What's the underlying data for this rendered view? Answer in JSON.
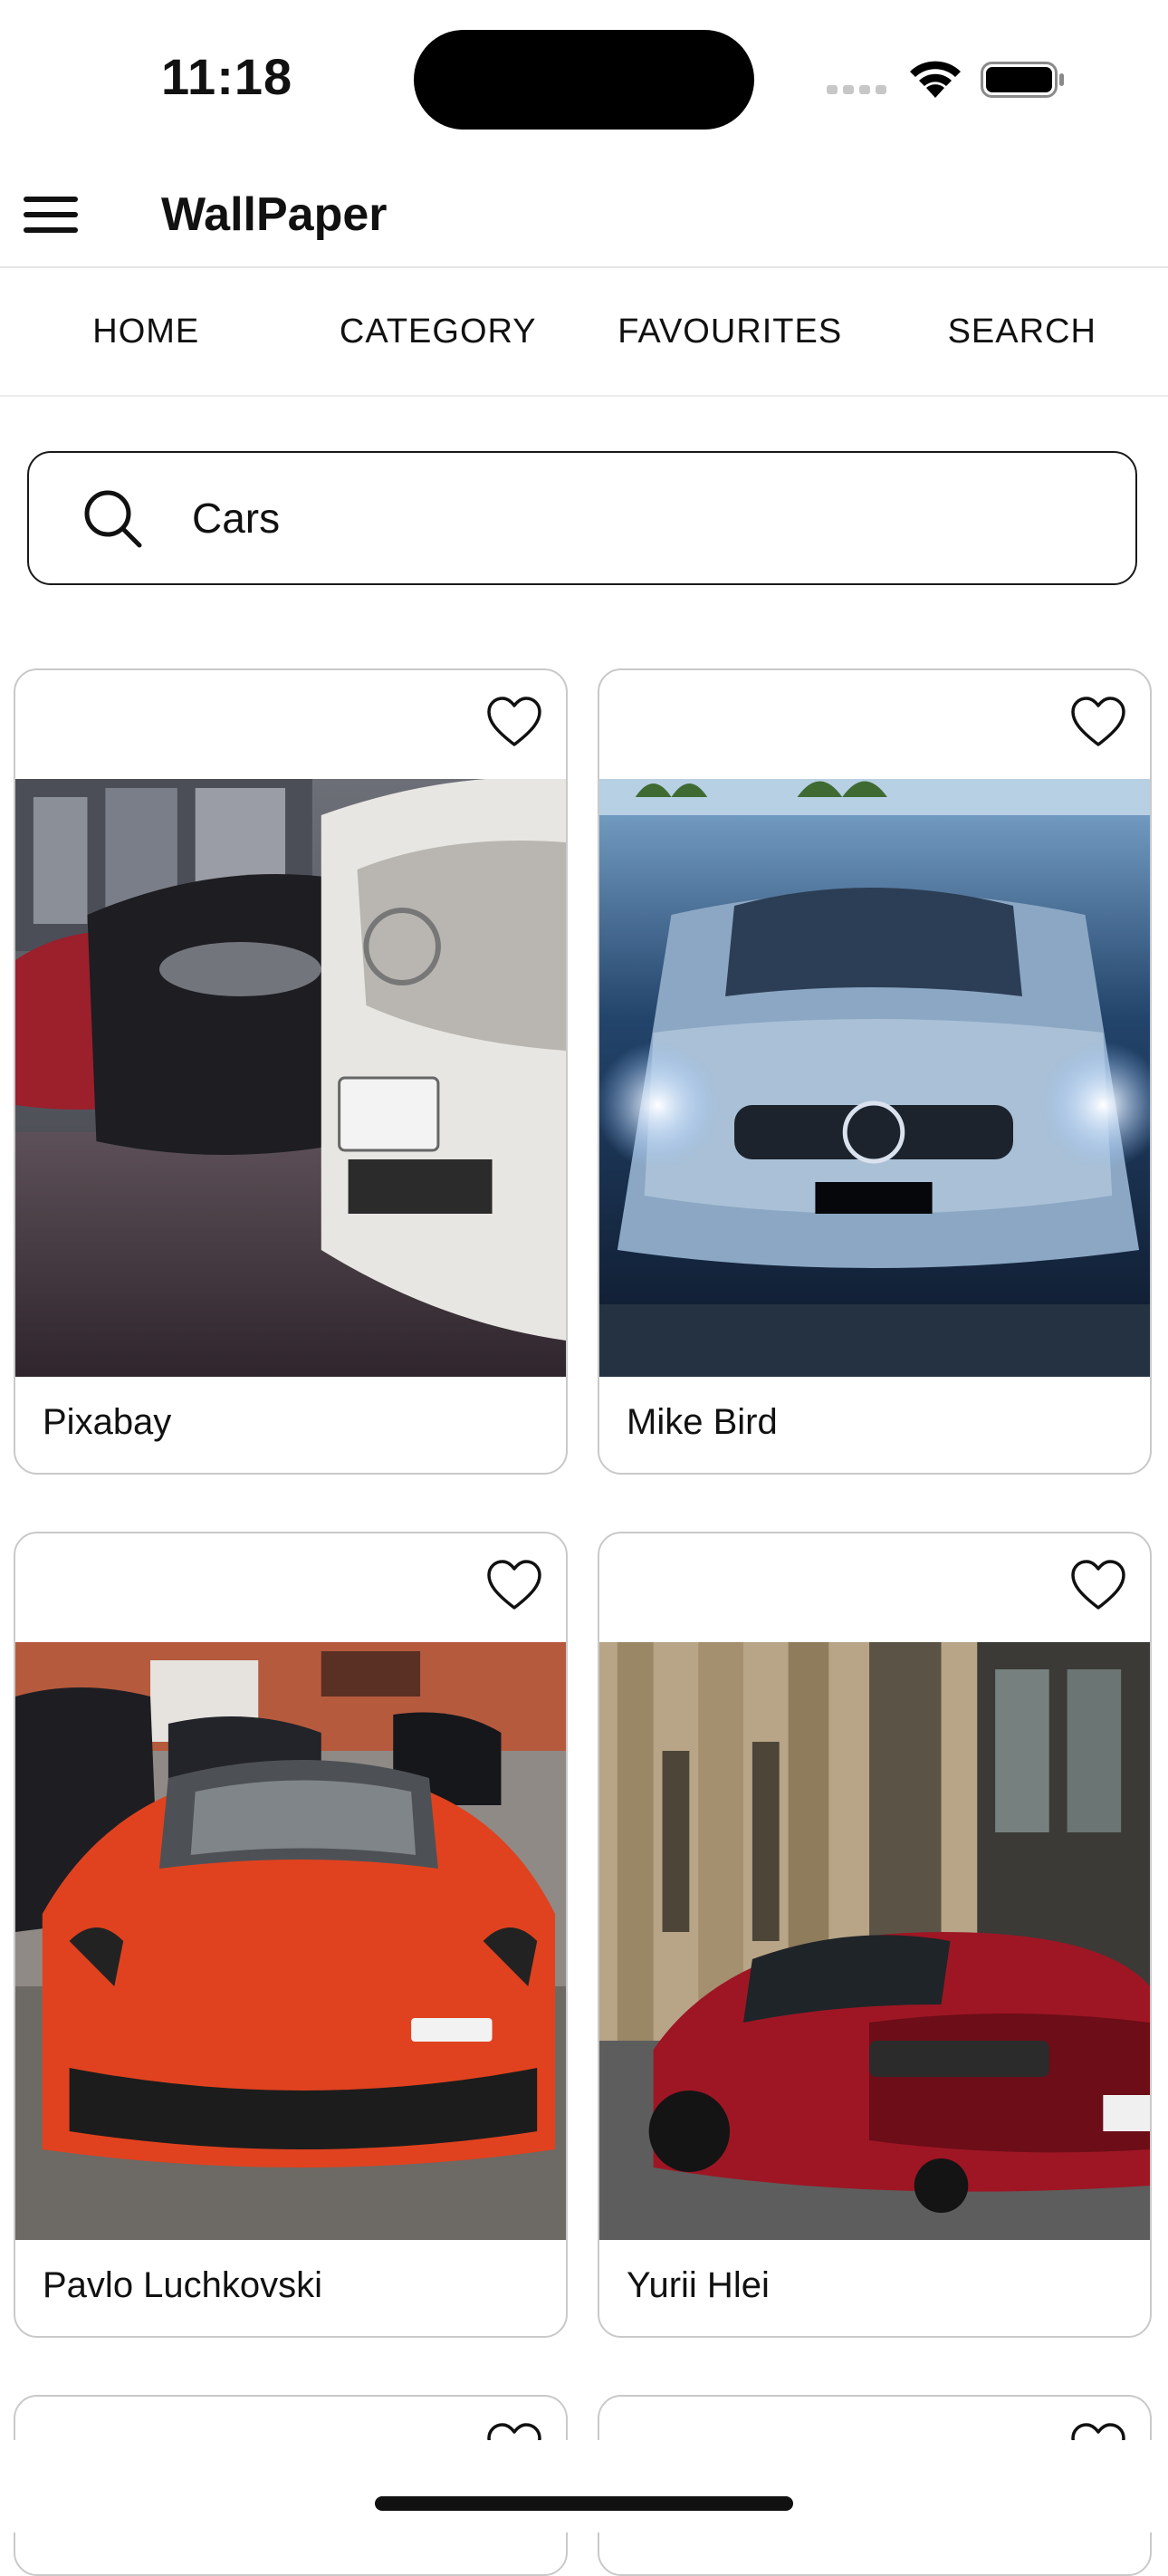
{
  "status_bar": {
    "time": "11:18"
  },
  "app_bar": {
    "title": "WallPaper",
    "menu_icon": "hamburger-menu-icon"
  },
  "tabs": [
    {
      "label": "HOME"
    },
    {
      "label": "CATEGORY"
    },
    {
      "label": "FAVOURITES"
    },
    {
      "label": "SEARCH"
    }
  ],
  "search": {
    "value": "Cars",
    "icon": "search-icon"
  },
  "wallpapers": [
    {
      "author": "Pixabay",
      "favorite": false,
      "subject": "row of parked Mercedes cars"
    },
    {
      "author": "Mike Bird",
      "favorite": false,
      "subject": "blue Mercedes front with headlights"
    },
    {
      "author": "Pavlo Luchkovski",
      "favorite": false,
      "subject": "red Ferrari in parking lot"
    },
    {
      "author": "Yurii Hlei",
      "favorite": false,
      "subject": "red Audi R8 on street"
    }
  ],
  "colors": {
    "text": "#111111",
    "card_border": "#c9c9c9",
    "divider": "#e6e6e6"
  }
}
